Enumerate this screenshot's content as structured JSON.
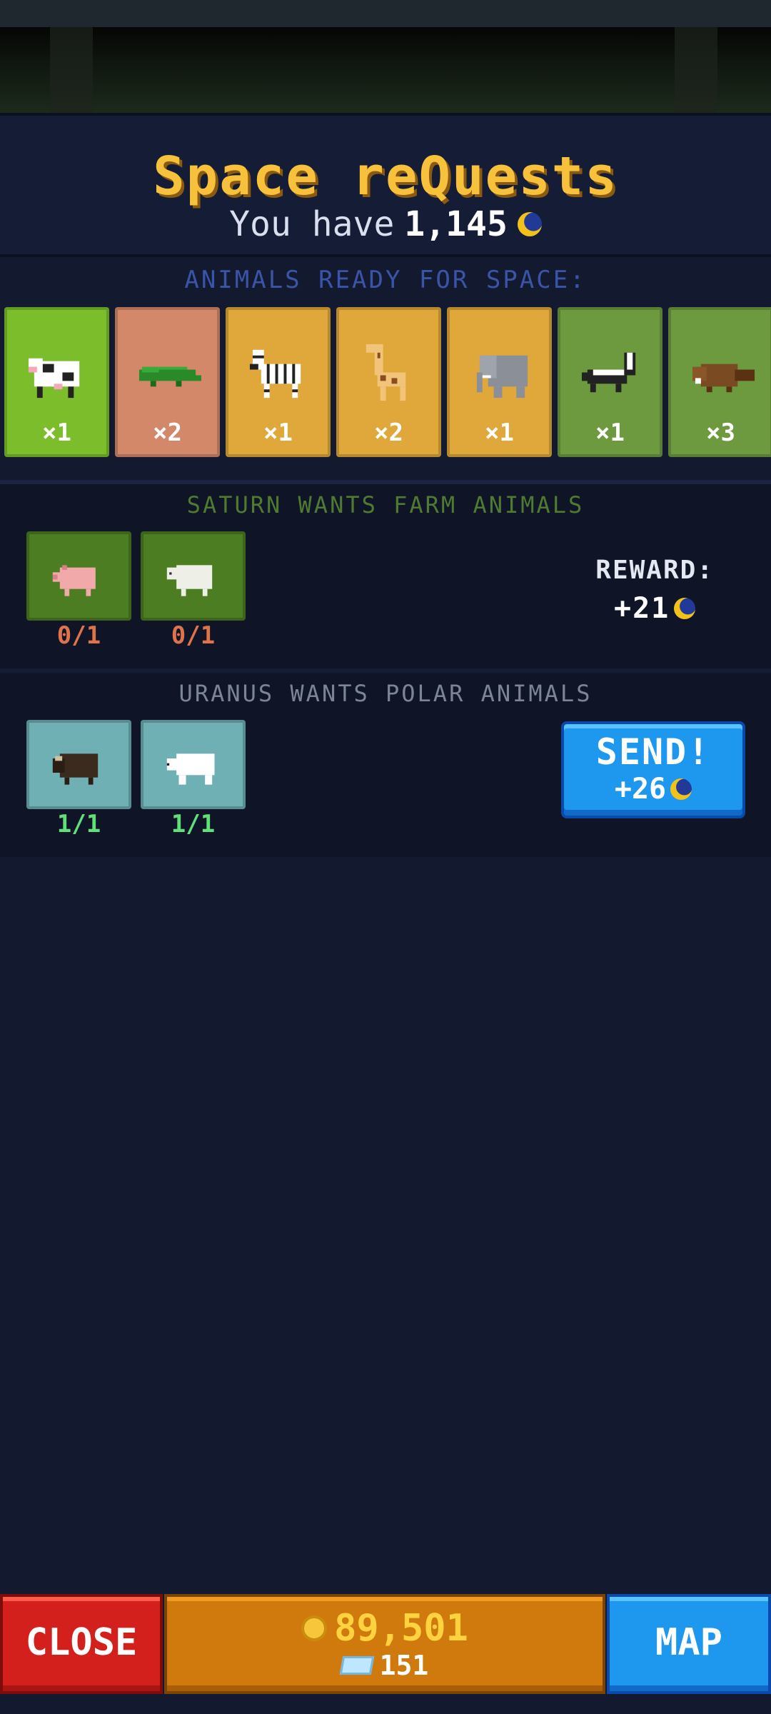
{
  "header": {
    "title": "Space reQuests",
    "balance_prefix": "You have",
    "balance_value": "1,145",
    "currency_icon": "moon-icon"
  },
  "ready": {
    "title": "ANIMALS READY FOR SPACE:",
    "animals": [
      {
        "name": "cow",
        "count": "×1",
        "bg": "#7bbd2b"
      },
      {
        "name": "crocodile",
        "count": "×2",
        "bg": "#d4886a"
      },
      {
        "name": "zebra",
        "count": "×1",
        "bg": "#e0a83a"
      },
      {
        "name": "giraffe",
        "count": "×2",
        "bg": "#e0a83a"
      },
      {
        "name": "elephant",
        "count": "×1",
        "bg": "#e0a83a"
      },
      {
        "name": "skunk",
        "count": "×1",
        "bg": "#6d9a3f"
      },
      {
        "name": "beaver",
        "count": "×3",
        "bg": "#6d9a3f"
      }
    ]
  },
  "requests": [
    {
      "title": "SATURN WANTS FARM ANIMALS",
      "title_color": "#4f7a32",
      "slot_bg": "#4c7d22",
      "progress_color": "#e0734a",
      "slots": [
        {
          "animal": "pig",
          "progress": "0/1"
        },
        {
          "animal": "sheep",
          "progress": "0/1"
        }
      ],
      "reward_label": "REWARD:",
      "reward_value": "+21"
    },
    {
      "title": "URANUS WANTS POLAR ANIMALS",
      "title_color": "#7c8597",
      "slot_bg": "#6fb0b4",
      "progress_color": "#5fe07a",
      "slots": [
        {
          "animal": "musk-ox",
          "progress": "1/1"
        },
        {
          "animal": "polar-bear",
          "progress": "1/1"
        }
      ],
      "send_label": "SEND!",
      "send_value": "+26"
    }
  ],
  "footer": {
    "close_label": "CLOSE",
    "coins": "89,501",
    "gems": "151",
    "map_label": "MAP"
  }
}
